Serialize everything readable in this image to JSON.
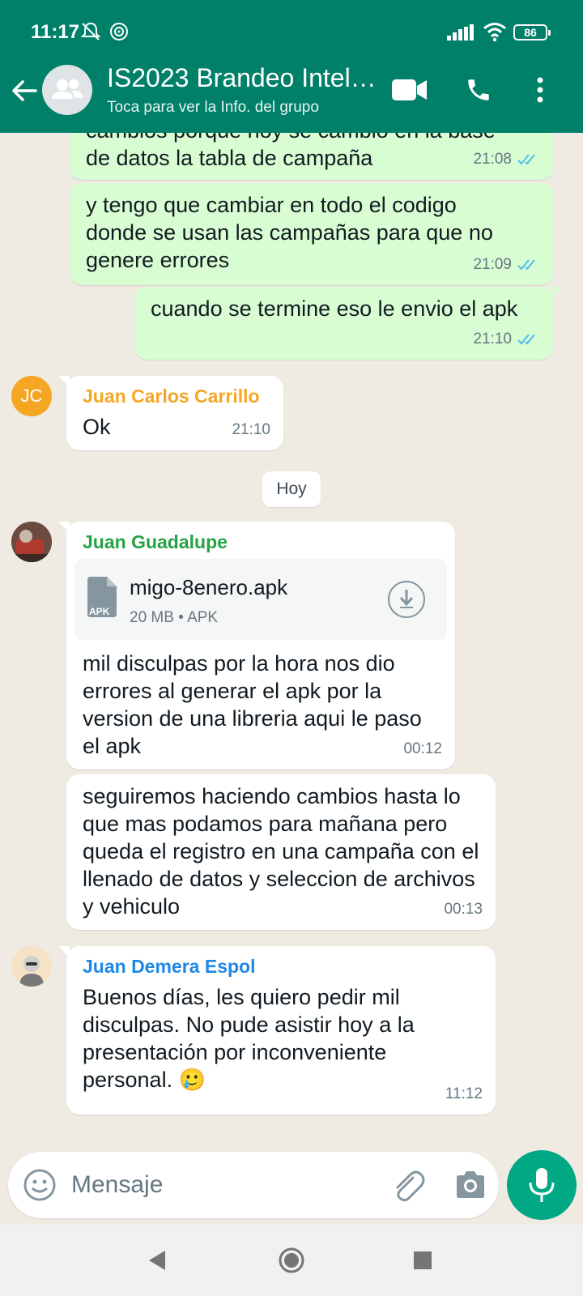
{
  "status_bar": {
    "time": "11:17",
    "battery": "86"
  },
  "header": {
    "title": "IS2023 Brandeo Intel…",
    "subtitle": "Toca para ver la Info. del grupo"
  },
  "messages": [
    {
      "type": "out",
      "text_lines": [
        "cambios porque hoy se cambio en la base",
        "de datos la tabla de campaña"
      ],
      "time": "21:08"
    },
    {
      "type": "out",
      "text": "y tengo que cambiar en todo el codigo donde se usan las campañas para que no genere errores",
      "time": "21:09"
    },
    {
      "type": "out",
      "text": "cuando se termine eso le envio el apk",
      "time": "21:10"
    },
    {
      "type": "in",
      "sender": "Juan Carlos Carrillo",
      "initials": "JC",
      "text": "Ok",
      "time": "21:10"
    },
    {
      "type": "in",
      "sender": "Juan Guadalupe",
      "document": {
        "name": "migo-8enero.apk",
        "meta": "20 MB • APK",
        "icon_label": "APK"
      },
      "text": "mil disculpas por la hora nos dio errores al generar el apk por la version de una libreria aqui le paso el apk",
      "time": "00:12"
    },
    {
      "type": "in",
      "text": "seguiremos haciendo cambios hasta lo que mas podamos para mañana pero queda el registro en una campaña con el llenado de datos y seleccion de archivos y vehiculo",
      "time": "00:13"
    },
    {
      "type": "in",
      "sender": "Juan Demera Espol",
      "text": "Buenos días, les quiero pedir mil disculpas. No pude asistir hoy a la presentación por  inconveniente personal. 🥲",
      "time": "11:12"
    }
  ],
  "day_separator": "Hoy",
  "composer": {
    "placeholder": "Mensaje"
  },
  "colors": {
    "header": "#008069",
    "outgoing_bubble": "#d9fdd3",
    "incoming_bubble": "#ffffff",
    "sender_juan_carlos": "#f5a623",
    "sender_juan_guadalupe": "#25a244",
    "sender_juan_demera": "#1e88e5",
    "read_ticks": "#53bdeb",
    "mic_button": "#00a884"
  },
  "icons": [
    "back-arrow-icon",
    "group-avatar-icon",
    "video-call-icon",
    "phone-icon",
    "more-options-icon",
    "emoji-icon",
    "attach-icon",
    "camera-icon",
    "mic-icon",
    "download-icon",
    "document-icon"
  ]
}
